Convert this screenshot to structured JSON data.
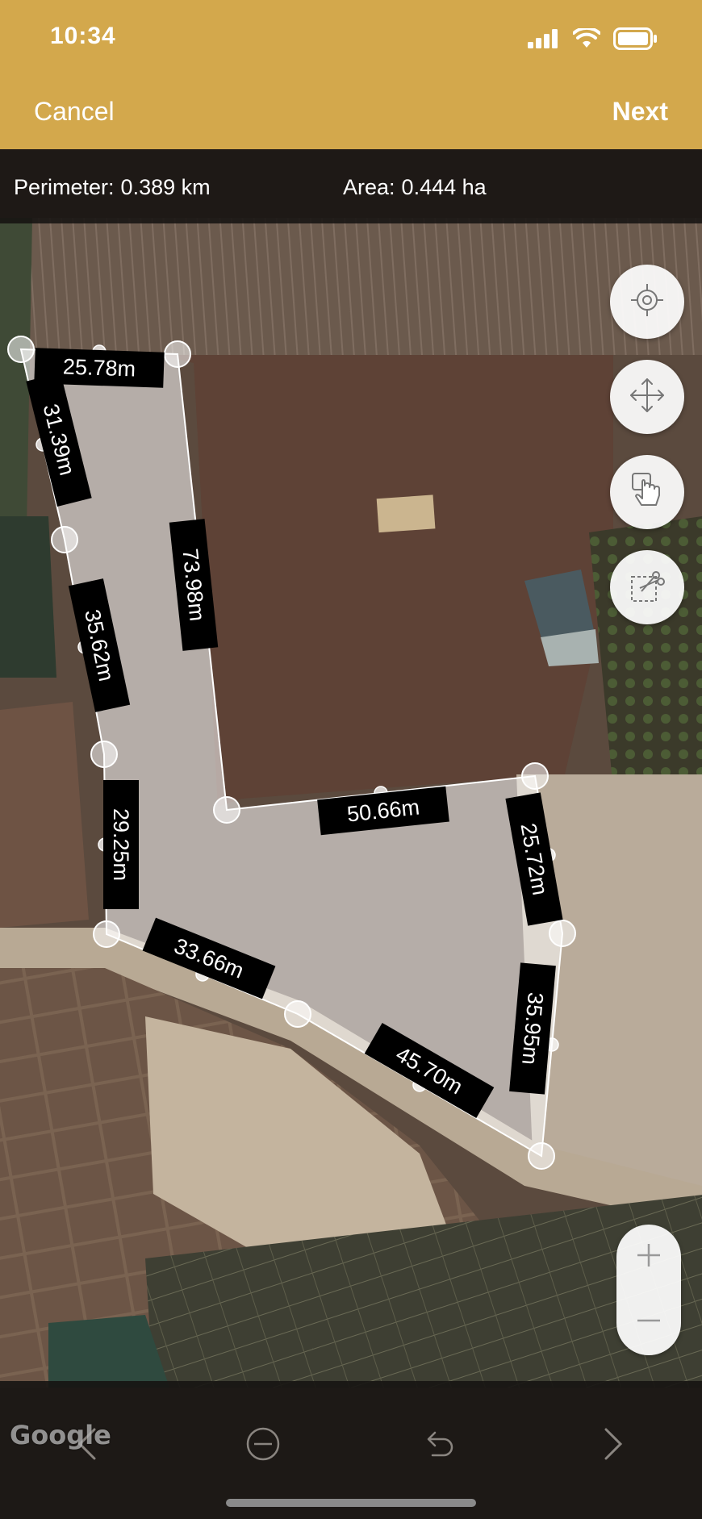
{
  "status_bar": {
    "time": "10:34"
  },
  "nav": {
    "cancel_label": "Cancel",
    "next_label": "Next"
  },
  "metrics": {
    "perimeter_label": "Perimeter:",
    "perimeter_value": "0.389 km",
    "area_label": "Area:",
    "area_value": "0.444 ha"
  },
  "segments": [
    {
      "label": "25.78m"
    },
    {
      "label": "73.98m"
    },
    {
      "label": "50.66m"
    },
    {
      "label": "25.72m"
    },
    {
      "label": "35.95m"
    },
    {
      "label": "45.70m"
    },
    {
      "label": "33.66m"
    },
    {
      "label": "29.25m"
    },
    {
      "label": "35.62m"
    },
    {
      "label": "31.39m"
    }
  ],
  "tools": [
    {
      "icon": "locate-icon"
    },
    {
      "icon": "move-icon"
    },
    {
      "icon": "tap-icon"
    },
    {
      "icon": "cut-icon"
    }
  ],
  "zoom": {
    "in_icon": "plus-icon",
    "out_icon": "minus-icon"
  },
  "bottom_toolbar": [
    {
      "icon": "chevron-left-icon"
    },
    {
      "icon": "remove-icon"
    },
    {
      "icon": "undo-icon"
    },
    {
      "icon": "chevron-right-icon"
    }
  ],
  "map": {
    "attribution": "Google"
  },
  "colors": {
    "accent": "#d3a84c",
    "polygon_fill": "#ffffff",
    "label_bg": "#000000"
  }
}
